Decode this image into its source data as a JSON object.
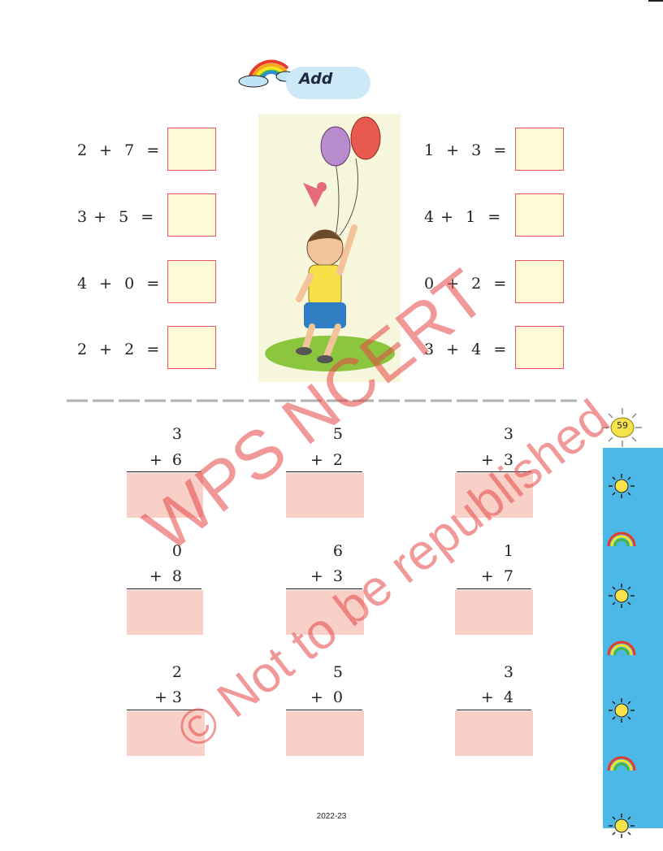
{
  "header": {
    "title": "Add"
  },
  "left_equations": [
    "2  +  7  =",
    "3 +  5  =",
    "4  +  0  =",
    "2  +  2  ="
  ],
  "right_equations": [
    "1  +  3  =",
    "4 +  1  =",
    "0  +  2  =",
    "3  +  4  ="
  ],
  "column_problems": [
    {
      "top": "3",
      "bottom": "+  6"
    },
    {
      "top": "5",
      "bottom": "+  2"
    },
    {
      "top": "3",
      "bottom": "+  3"
    },
    {
      "top": "0",
      "bottom": "+  8"
    },
    {
      "top": "6",
      "bottom": "+  3"
    },
    {
      "top": "1",
      "bottom": "+  7"
    },
    {
      "top": "2",
      "bottom": "+ 3"
    },
    {
      "top": "5",
      "bottom": "+  0"
    },
    {
      "top": "3",
      "bottom": "+  4"
    }
  ],
  "page_number": "59",
  "footer": {
    "year": "2022-23"
  },
  "watermark": {
    "line1": "WPS NCERT",
    "line2": "© Not to be republished"
  },
  "colors": {
    "answer_box_fill": "#fff9d6",
    "answer_box_border": "#e8546a",
    "column_answer_fill": "#f9d0c7",
    "side_strip": "#4cb8e8",
    "watermark": "#e64646"
  },
  "icons": [
    "rainbow-cloud-icon",
    "boy-with-balloons-illustration",
    "sun-icon",
    "rainbow-icon"
  ]
}
